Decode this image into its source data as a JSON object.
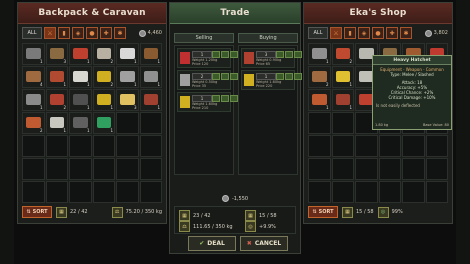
{
  "left_panel": {
    "title": "Backpack & Caravan",
    "filter_all": "ALL",
    "money": "4,460",
    "sort_label": "SORT",
    "slots_used": "22 / 42",
    "weight": "75.20 / 350 kg",
    "items": [
      {
        "color": "#7a7a7a",
        "qty": "1"
      },
      {
        "color": "#8a6a40",
        "qty": "3"
      },
      {
        "color": "#c04030",
        "qty": "1"
      },
      {
        "color": "#b8b0a0",
        "qty": "2"
      },
      {
        "color": "#d8d8d8",
        "qty": "1"
      },
      {
        "color": "#8a5a30",
        "qty": "1"
      },
      {
        "color": "#a06a40",
        "qty": "4"
      },
      {
        "color": "#b04a30",
        "qty": "1"
      },
      {
        "color": "#d8d8d0",
        "qty": "1"
      },
      {
        "color": "#d0b020",
        "qty": "2"
      },
      {
        "color": "#a0a0a0",
        "qty": "1"
      },
      {
        "color": "#909090",
        "qty": "1"
      },
      {
        "color": "#8a8a8a",
        "qty": "1"
      },
      {
        "color": "#b04030",
        "qty": "2"
      },
      {
        "color": "#505050",
        "qty": "1"
      },
      {
        "color": "#d0b020",
        "qty": "1"
      },
      {
        "color": "#e0c060",
        "qty": "3"
      },
      {
        "color": "#a04030",
        "qty": "1"
      },
      {
        "color": "#c05a30",
        "qty": "2"
      },
      {
        "color": "#c8c8c0",
        "qty": "1"
      },
      {
        "color": "#606060",
        "qty": "1"
      },
      {
        "color": "#30a060",
        "qty": "1"
      }
    ]
  },
  "trade": {
    "title": "Trade",
    "selling_label": "Selling",
    "buying_label": "Buying",
    "selling_rows": [
      {
        "color": "#c03030",
        "qty": "1",
        "info": "Weight 1.20kg\nPrice 120"
      },
      {
        "color": "#a0a0a0",
        "qty": "2",
        "info": "Weight 0.50kg\nPrice 35"
      },
      {
        "color": "#d0b020",
        "qty": "1",
        "info": "Weight 1.60kg\nPrice 210"
      }
    ],
    "buying_rows": [
      {
        "color": "#b04030",
        "qty": "3",
        "info": "Weight 0.90kg\nPrice 65"
      },
      {
        "color": "#d0b020",
        "qty": "1",
        "info": "Weight 1.60kg\nPrice 220"
      }
    ],
    "balance": "-1,550",
    "left_slots": "23 / 42",
    "left_weight": "111.65 / 350 kg",
    "right_slots": "15 / 58",
    "right_weight": "+9.9%",
    "deal_label": "DEAL",
    "cancel_label": "CANCEL"
  },
  "right_panel": {
    "title": "Eka's Shop",
    "filter_all": "ALL",
    "money": "3,802",
    "sort_label": "SORT",
    "slots_used": "15 / 58",
    "reputation": "99%",
    "items": [
      {
        "color": "#909090",
        "qty": "1"
      },
      {
        "color": "#c04a30",
        "qty": "2"
      },
      {
        "color": "#b8b8b0",
        "qty": "1"
      },
      {
        "color": "#8a6a40",
        "qty": "1"
      },
      {
        "color": "#a05a30",
        "qty": "1"
      },
      {
        "color": "#c03a30",
        "qty": "1"
      },
      {
        "color": "#a06a40",
        "qty": "2"
      },
      {
        "color": "#e0c030",
        "qty": "1"
      },
      {
        "color": "#c0c0b8",
        "qty": "3"
      },
      {
        "color": "#d0b020",
        "qty": "1"
      },
      {
        "color": "#909090",
        "qty": "1"
      },
      {
        "color": "#c04030",
        "qty": "1"
      },
      {
        "color": "#c05a30",
        "qty": "1"
      },
      {
        "color": "#a04030",
        "qty": "1"
      },
      {
        "color": "#c04030",
        "qty": "2"
      }
    ]
  },
  "tooltip": {
    "title": "Heavy Hatchet",
    "subtitle": "Equipment · Weapon · Common",
    "type": "Type: Melee / Slashed",
    "stats": [
      "Attack: 18",
      "Accuracy: +5%",
      "Critical Chance: +2%",
      "Critical Damage: +10%"
    ],
    "note": "Is not easily deflected",
    "weight": "1.80 kg",
    "value": "Base Value: 80"
  },
  "colors": {
    "panel_red": "#5a2a22",
    "trade_green": "#3e5a3e",
    "accent_orange": "#c0642c"
  }
}
